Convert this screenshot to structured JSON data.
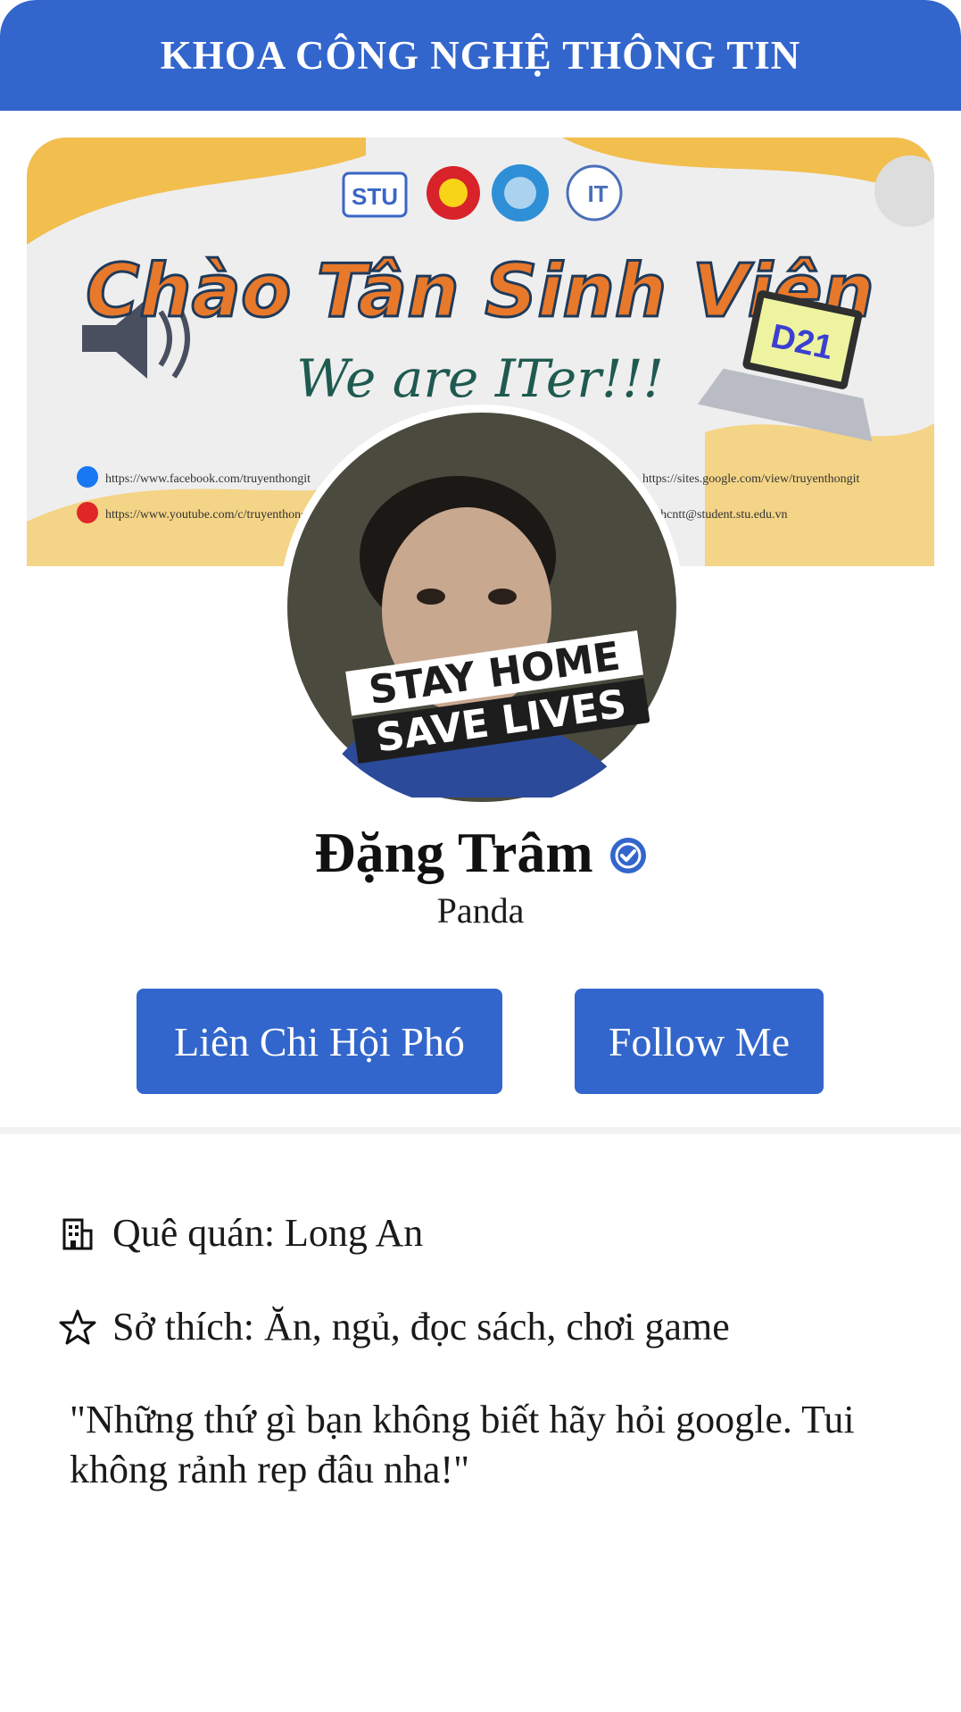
{
  "header": {
    "title": "KHOA CÔNG NGHỆ THÔNG TIN"
  },
  "cover": {
    "banner_title": "Chào Tân Sinh Viên",
    "banner_subtitle": "We are ITer!!!",
    "badge": "D21",
    "logo_text": "STU",
    "links": {
      "facebook": "https://www.facebook.com/truyenthongit",
      "youtube": "https://www.youtube.com/c/truyenthongit",
      "site": "https://sites.google.com/view/truyenthongit",
      "email": "lchcntt@student.stu.edu.vn"
    }
  },
  "avatar": {
    "overlay_line1": "STAY HOME",
    "overlay_line2": "SAVE LIVES"
  },
  "profile": {
    "name": "Đặng Trâm",
    "nickname": "Panda",
    "verified_icon": "verified-check-icon"
  },
  "buttons": {
    "role_label": "Liên Chi Hội Phó",
    "follow_label": "Follow Me"
  },
  "info": {
    "hometown_icon": "building-icon",
    "hometown": "Quê quán: Long An",
    "hobbies_icon": "star-outline-icon",
    "hobbies": "Sở thích: Ăn, ngủ, đọc sách, chơi game"
  },
  "quote": "\"Những thứ gì bạn không biết hãy hỏi google. Tui không rảnh rep đâu nha!\"",
  "colors": {
    "primary": "#3366cc",
    "banner_yellow": "#f2b531",
    "banner_orange": "#e8792b"
  }
}
